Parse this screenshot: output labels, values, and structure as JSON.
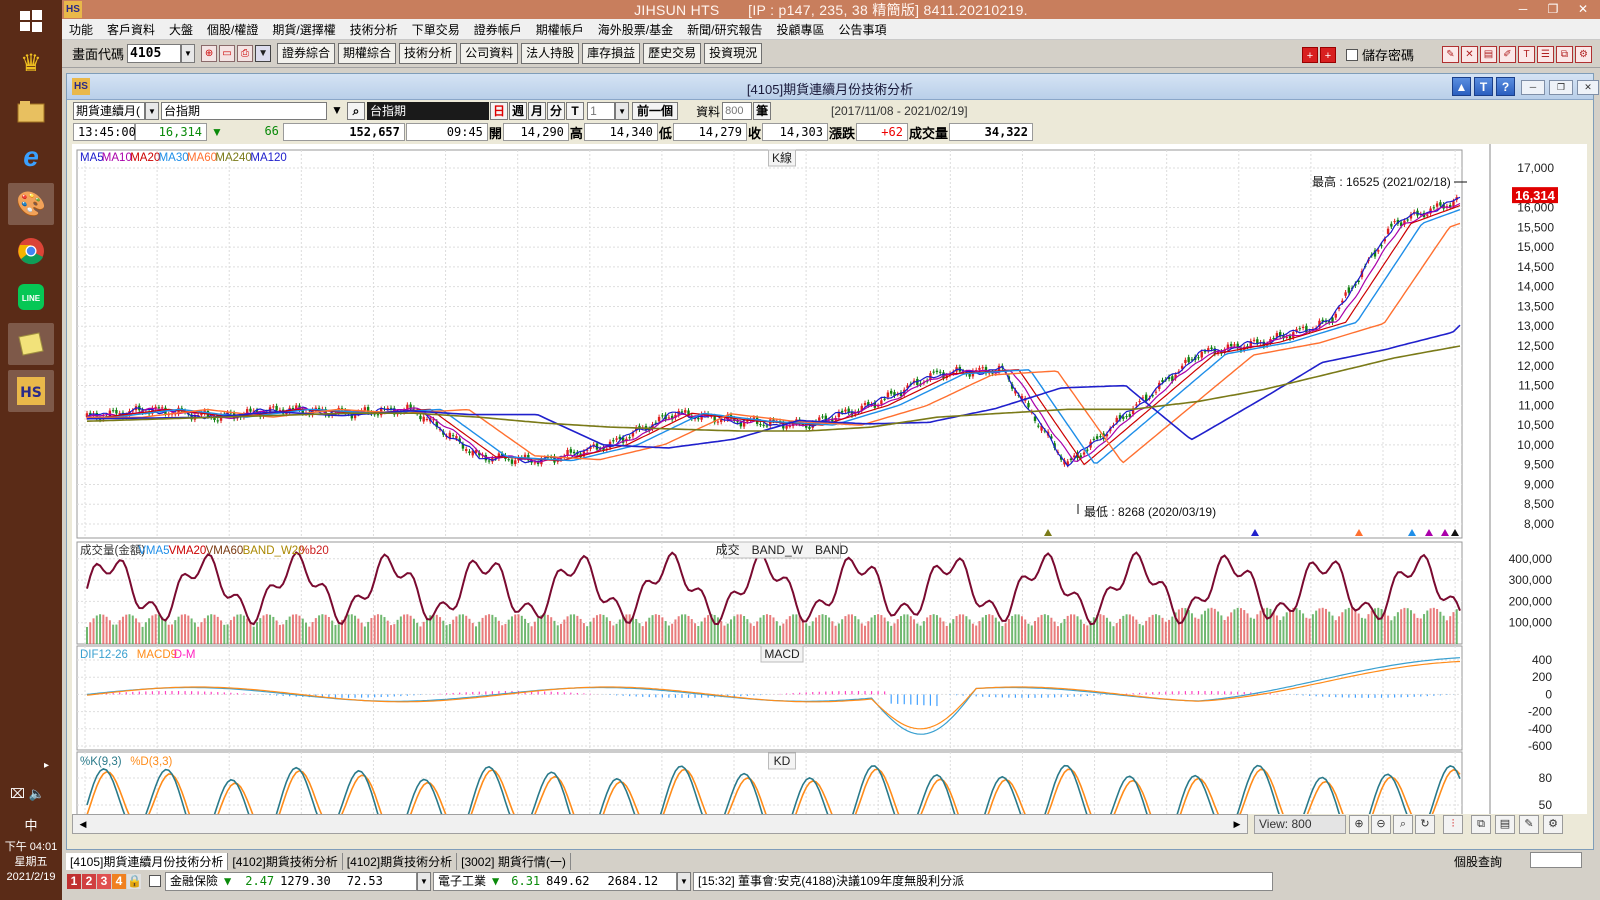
{
  "taskbar": {
    "icons": [
      "windows-icon",
      "crown-icon",
      "file-manager-icon",
      "ie-icon",
      "paint-icon",
      "chrome-icon",
      "line-icon",
      "notes-icon",
      "jihsun-icon"
    ],
    "ime": "中",
    "time": "下午 04:01",
    "weekday": "星期五",
    "date": "2021/2/19"
  },
  "titlebar": {
    "logo": "HS",
    "title": "JIHSUN HTS　　[IP : p147, 235, 38 精簡版] 8411.20210219.",
    "min": "─",
    "max": "❐",
    "close": "✕"
  },
  "menu": [
    "功能",
    "客戶資料",
    "大盤",
    "個股/權證",
    "期貨/選擇權",
    "技術分析",
    "下單交易",
    "證券帳戶",
    "期權帳戶",
    "海外股票/基金",
    "新聞/研究報告",
    "投顧專區",
    "公告事項"
  ],
  "toolbar": {
    "code_label": "畫面代碼",
    "code_value": "4105",
    "quick_buttons": [
      "證券綜合",
      "期權綜合",
      "技術分析",
      "公司資料",
      "法人持股",
      "庫存損益",
      "歷史交易",
      "投資現況"
    ],
    "save_password": "儲存密碼"
  },
  "inner": {
    "title": "[4105]期貨連續月份技術分析",
    "help_buttons": [
      "▲",
      "T",
      "?"
    ],
    "product_select": "期貨連續月(",
    "index_name": "台指期",
    "index_display": "台指期",
    "periods": [
      "日",
      "週",
      "月",
      "分",
      "T"
    ],
    "period_count": "1",
    "prev_button": "前一個",
    "data_label": "資料",
    "data_count": "800",
    "data_unit": "筆",
    "date_range": "[2017/11/08 - 2021/02/19]"
  },
  "quote": {
    "time": "13:45:00",
    "last": "16,314",
    "arrow": "▼",
    "change": "66",
    "volume_total": "152,657",
    "bar_time": "09:45",
    "open_label": "開",
    "open": "14,290",
    "high_label": "高",
    "high": "14,340",
    "low_label": "低",
    "low": "14,279",
    "close_label": "收",
    "close": "14,303",
    "chg_label": "漲跌",
    "chg": "+62",
    "vol_label": "成交量",
    "vol": "34,322"
  },
  "colors": {
    "ma5": "#1a1acc",
    "ma10": "#aa00aa",
    "ma20": "#cc0000",
    "ma30": "#1e8ee8",
    "ma60": "#ff7030",
    "ma240": "#7a7a18",
    "ma120": "#2020cc",
    "vol_line": "#7a0a30",
    "dif": "#3aa0d0",
    "macd": "#ff8c1a",
    "k": "#2a7a8a",
    "d": "#ff8c1a"
  },
  "chart_data": {
    "type": "line",
    "x": [
      "2017/11",
      "2018/01",
      "2018/03",
      "2018/05",
      "2018/07",
      "2018/09",
      "2018/10",
      "2018/12",
      "2019/02",
      "2019/04",
      "2019/06",
      "2019/08",
      "2019/10",
      "2019/12",
      "2020/01",
      "2020/03",
      "2020/05",
      "2020/07",
      "2020/09",
      "2020/11",
      "2021/01",
      "2021/02"
    ],
    "series": [
      {
        "name": "MA5",
        "values": [
          10700,
          10900,
          10700,
          10900,
          10800,
          10900,
          9700,
          9600,
          10000,
          10800,
          10600,
          10500,
          11000,
          11800,
          11900,
          9500,
          10900,
          12300,
          12600,
          13100,
          15600,
          16200
        ]
      },
      {
        "name": "MA240",
        "values": [
          10600,
          10650,
          10700,
          10750,
          10800,
          10800,
          10700,
          10550,
          10450,
          10400,
          10350,
          10350,
          10450,
          10700,
          10800,
          10900,
          10900,
          11100,
          11400,
          11800,
          12200,
          12500
        ]
      }
    ],
    "ylim": [
      8000,
      17000
    ],
    "yticks": [
      8000,
      8500,
      9000,
      9500,
      10000,
      10500,
      11000,
      11500,
      12000,
      12500,
      13000,
      13500,
      14000,
      14500,
      15000,
      15500,
      16000,
      17000
    ],
    "last_price_tag": "16,314",
    "annotations": [
      "最高 : 16525 (2021/02/18)",
      "最低 : 8268 (2020/03/19)"
    ],
    "x_ticks": [
      "2017/11/08",
      "2018/02",
      "2018/04",
      "2018/06",
      "2018/08",
      "2018/10",
      "2018/12",
      "2019/02",
      "2019/04",
      "2019/06",
      "2019/08",
      "2019/10",
      "2019/12",
      "2020/02",
      "2020/04",
      "2020/06",
      "2020/08",
      "2020/10",
      "2020/12",
      "02/19"
    ],
    "panels": [
      {
        "name": "K線",
        "legend": [
          "MA5",
          "MA10",
          "MA20",
          "MA30",
          "MA60",
          "MA240",
          "MA120"
        ]
      },
      {
        "name": "成交　BAND_W　BAND",
        "legend": [
          "成交量(金額)",
          "VMA5",
          "VMA20",
          "VMA60",
          "BAND_W20",
          "%b20"
        ],
        "yticks": [
          "400,000",
          "300,000",
          "200,000",
          "100,000"
        ]
      },
      {
        "name": "MACD",
        "legend": [
          "DIF12-26",
          "MACD9",
          "D-M"
        ],
        "yticks": [
          "400",
          "200",
          "0",
          "-200",
          "-400",
          "-600"
        ]
      },
      {
        "name": "KD",
        "legend": [
          "%K(9,3)",
          "%D(3,3)"
        ],
        "yticks": [
          "80",
          "50",
          "20"
        ]
      }
    ]
  },
  "footer": {
    "view_label": "View:",
    "view_value": "800",
    "tabs": [
      "[4105]期貨連續月份技術分析",
      "[4102]期貨技術分析",
      "[4102]期貨技術分析",
      "[3002] 期貨行情(一)"
    ],
    "right_label": "個股查詢",
    "ticker_nums": [
      "1",
      "2",
      "3",
      "4"
    ],
    "ticker": {
      "cat1": "金融保險",
      "cat1_arrow": "▼",
      "cat1_chg": "2.47",
      "cat1_val": "1279.30",
      "cat1_vol": "72.53",
      "cat2": "電子工業",
      "cat2_arrow": "▼",
      "cat2_chg": "6.31",
      "cat2_val": "849.62",
      "cat2_vol": "2684.12",
      "news": "[15:32] 董事會:安克(4188)決議109年度無股利分派"
    }
  }
}
